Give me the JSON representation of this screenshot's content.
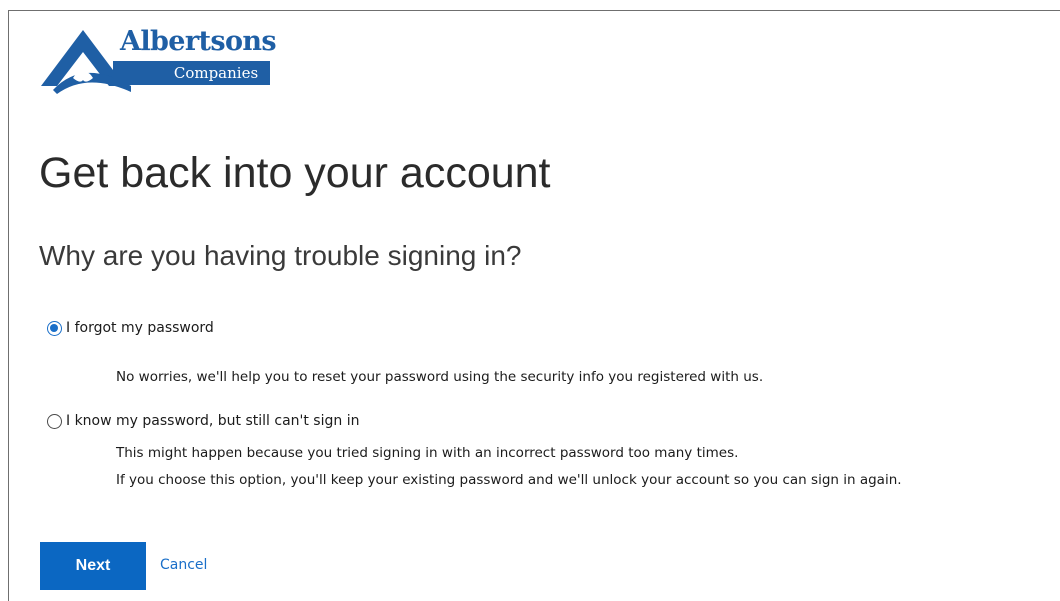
{
  "logo": {
    "name": "Albertsons",
    "sub": "Companies"
  },
  "page": {
    "title": "Get back into your account",
    "subtitle": "Why are you having trouble signing in?"
  },
  "options": [
    {
      "label": "I forgot my password",
      "selected": true,
      "descriptions": [
        "No worries, we'll help you to reset your password using the security info you registered with us."
      ]
    },
    {
      "label": "I know my password, but still can't sign in",
      "selected": false,
      "descriptions": [
        "This might happen because you tried signing in with an incorrect password too many times.",
        "If you choose this option, you'll keep your existing password and we'll unlock your account so you can sign in again."
      ]
    }
  ],
  "actions": {
    "next_label": "Next",
    "cancel_label": "Cancel"
  },
  "colors": {
    "accent": "#0b67c2",
    "logo_blue": "#1f5fa5",
    "link": "#1a6fc9"
  }
}
